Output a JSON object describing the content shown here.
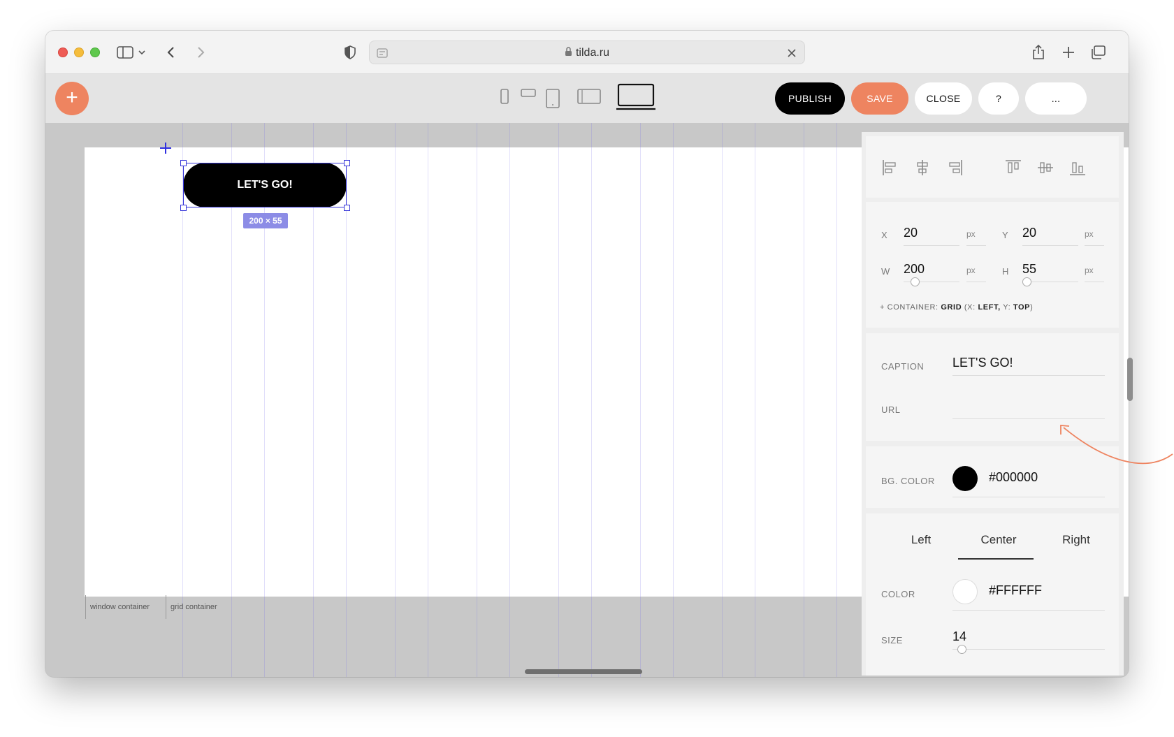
{
  "browser": {
    "url": "tilda.ru"
  },
  "toolbar": {
    "add_label": "+",
    "publish": "PUBLISH",
    "save": "SAVE",
    "close": "CLOSE",
    "help": "?",
    "more": "..."
  },
  "canvas": {
    "button_caption": "LET'S GO!",
    "size_badge": "200 × 55",
    "window_container_label": "window container",
    "grid_container_label": "grid container"
  },
  "panel": {
    "position": {
      "x_label": "X",
      "x_value": "20",
      "x_unit": "px",
      "y_label": "Y",
      "y_value": "20",
      "y_unit": "px",
      "w_label": "W",
      "w_value": "200",
      "w_unit": "px",
      "h_label": "H",
      "h_value": "55",
      "h_unit": "px",
      "container_prefix": "+ CONTAINER:",
      "container_grid": "GRID",
      "container_open": "(X:",
      "container_x": "LEFT,",
      "container_y_label": "Y:",
      "container_y": "TOP",
      "container_close": ")"
    },
    "content": {
      "caption_label": "CAPTION",
      "caption_value": "LET'S GO!",
      "url_label": "URL",
      "url_value": ""
    },
    "background": {
      "label": "BG. COLOR",
      "value": "#000000",
      "swatch_color": "#000000"
    },
    "typography": {
      "tabs": [
        "Left",
        "Center",
        "Right"
      ],
      "active_tab": "Center",
      "color_label": "COLOR",
      "color_value": "#FFFFFF",
      "swatch_color": "#FFFFFF",
      "size_label": "SIZE",
      "size_value": "14"
    }
  },
  "colors": {
    "accent": "#EE8460",
    "selection": "#3535D8"
  }
}
